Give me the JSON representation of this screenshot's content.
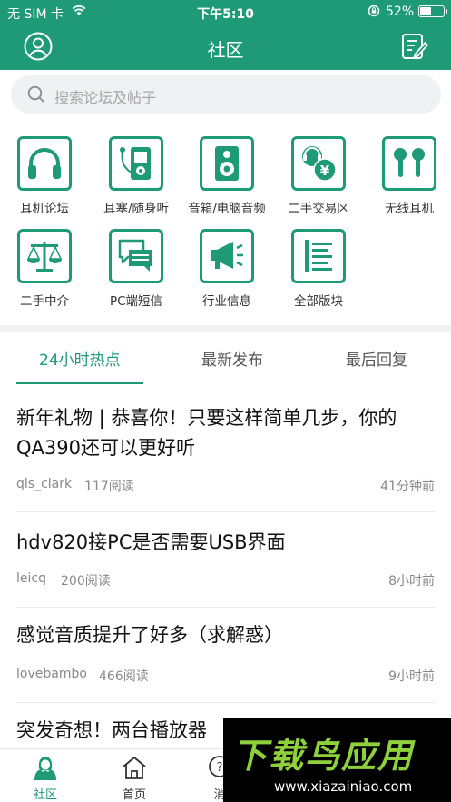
{
  "status_bar": {
    "carrier": "无 SIM 卡",
    "time": "下午5:10",
    "battery_percent": "52%",
    "battery_level": 0.52
  },
  "nav": {
    "title": "社区",
    "left_icon": "user-circle-icon",
    "right_icon": "compose-icon"
  },
  "search": {
    "placeholder": "搜索论坛及帖子"
  },
  "categories": [
    {
      "label": "耳机论坛",
      "icon": "headphones-icon"
    },
    {
      "label": "耳塞/随身听",
      "icon": "earbuds-player-icon"
    },
    {
      "label": "音箱/电脑音频",
      "icon": "speaker-icon"
    },
    {
      "label": "二手交易区",
      "icon": "trade-icon"
    },
    {
      "label": "无线耳机",
      "icon": "wireless-earbuds-icon"
    },
    {
      "label": "二手中介",
      "icon": "scale-icon"
    },
    {
      "label": "PC端短信",
      "icon": "chat-icon"
    },
    {
      "label": "行业信息",
      "icon": "megaphone-icon"
    },
    {
      "label": "全部版块",
      "icon": "list-icon"
    }
  ],
  "tabs": [
    {
      "label": "24小时热点",
      "active": true
    },
    {
      "label": "最新发布",
      "active": false
    },
    {
      "label": "最后回复",
      "active": false
    }
  ],
  "posts": [
    {
      "title": "新年礼物 | 恭喜你！只要这样简单几步，你的QA390还可以更好听",
      "author": "qls_clark",
      "reads": "117阅读",
      "time": "41分钟前"
    },
    {
      "title": "hdv820接PC是否需要USB界面",
      "author": "leicq",
      "reads": "200阅读",
      "time": "8小时前"
    },
    {
      "title": "感觉音质提升了好多（求解惑）",
      "author": "lovebambo",
      "reads": "466阅读",
      "time": "9小时前"
    },
    {
      "title": "突发奇想！两台播放器",
      "author": "",
      "reads": "",
      "time": ""
    }
  ],
  "tabbar": [
    {
      "label": "社区",
      "icon": "community-icon",
      "active": true
    },
    {
      "label": "首页",
      "icon": "home-icon",
      "active": false
    },
    {
      "label": "消",
      "icon": "message-icon",
      "active": false
    }
  ],
  "watermark": {
    "text": "下载鸟应用",
    "url": "www.xiazainiao.com"
  },
  "colors": {
    "brand": "#1e9a77",
    "separator": "#f2f2f4",
    "meta_text": "#888888"
  }
}
